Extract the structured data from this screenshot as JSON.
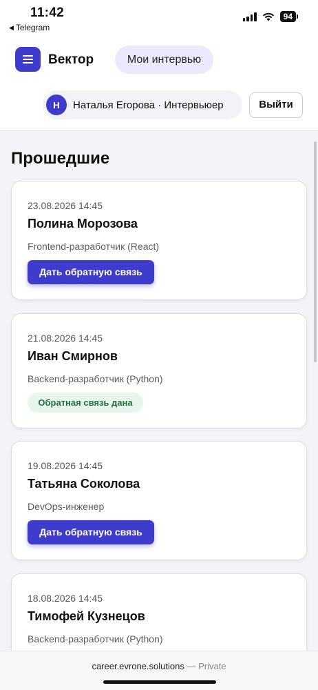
{
  "status_bar": {
    "time": "11:42",
    "back_app": "Telegram",
    "battery": "94"
  },
  "header": {
    "brand": "Вектор",
    "nav_label": "Мои интервью",
    "avatar_letter": "Н",
    "user_name": "Наталья Егорова · Интервьюер",
    "logout_label": "Выйти"
  },
  "main": {
    "section_title": "Прошедшие",
    "interviews": [
      {
        "date": "23.08.2026 14:45",
        "name": "Полина Морозова",
        "role": "Frontend-разработчик (React)",
        "action": "Дать обратную связь"
      },
      {
        "date": "21.08.2026 14:45",
        "name": "Иван Смирнов",
        "role": "Backend-разработчик (Python)",
        "status": "Обратная связь дана"
      },
      {
        "date": "19.08.2026 14:45",
        "name": "Татьяна Соколова",
        "role": "DevOps-инженер",
        "action": "Дать обратную связь"
      },
      {
        "date": "18.08.2026 14:45",
        "name": "Тимофей Кузнецов",
        "role": "Backend-разработчик (Python)"
      }
    ]
  },
  "browser": {
    "domain": "career.evrone.solutions",
    "privacy": "— Private"
  },
  "colors": {
    "accent": "#3f3bcd",
    "accent_soft": "#ebeafc",
    "success_bg": "#e7f6ec",
    "success_text": "#23703e"
  },
  "icons": {
    "menu": "hamburger-menu-icon",
    "signal": "cellular-signal-icon",
    "wifi": "wifi-icon",
    "back": "back-triangle-icon"
  }
}
